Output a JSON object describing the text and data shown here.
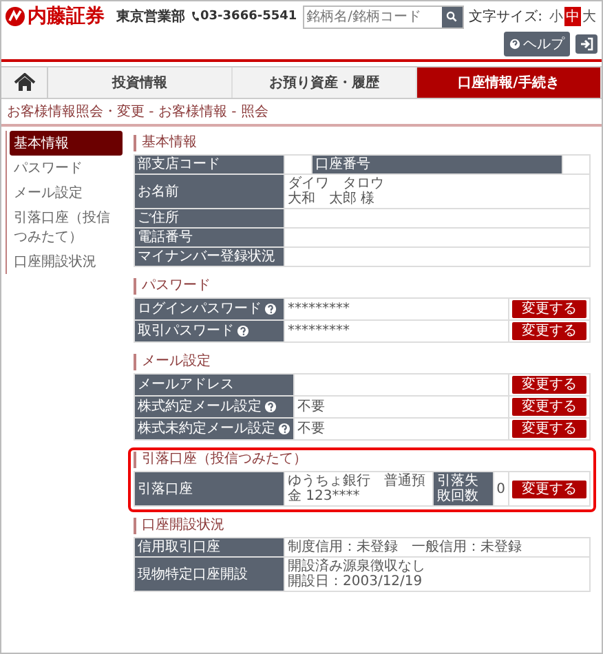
{
  "header": {
    "logo": "内藤証券",
    "branch": "東京営業部",
    "phone": "03-3666-5541",
    "search": {
      "placeholder": "銘柄名/銘柄コード"
    },
    "font_size": {
      "label": "文字サイズ:",
      "options": [
        {
          "label": "小",
          "selected": false
        },
        {
          "label": "中",
          "selected": true
        },
        {
          "label": "大",
          "selected": false
        }
      ]
    },
    "help": "ヘルプ"
  },
  "nav": {
    "tabs": [
      {
        "label": "投資情報",
        "selected": false
      },
      {
        "label": "お預り資産・履歴",
        "selected": false
      },
      {
        "label": "口座情報/手続き",
        "selected": true
      }
    ]
  },
  "breadcrumb": "お客様情報照会・変更 - お客様情報 - 照会",
  "sidebar": {
    "items": [
      {
        "label": "基本情報",
        "selected": true
      },
      {
        "label": "パスワード",
        "selected": false
      },
      {
        "label": "メール設定",
        "selected": false
      },
      {
        "label": "引落口座（投信つみたて）",
        "selected": false
      },
      {
        "label": "口座開設状況",
        "selected": false
      }
    ]
  },
  "sections": [
    {
      "title": "基本情報",
      "highlighted": false,
      "rows": [
        {
          "cells": [
            {
              "kind": "label",
              "text": "部支店コード",
              "help": false
            },
            {
              "kind": "value"
            },
            {
              "kind": "label",
              "text": "口座番号",
              "help": false
            },
            {
              "kind": "value"
            }
          ]
        },
        {
          "cells": [
            {
              "kind": "label",
              "text": "お名前",
              "help": false
            },
            {
              "kind": "value",
              "colspan": 3,
              "lines": [
                "ダイワ　タロウ",
                "大和　太郎 様"
              ]
            }
          ]
        },
        {
          "cells": [
            {
              "kind": "label",
              "text": "ご住所",
              "help": false
            },
            {
              "kind": "value",
              "colspan": 3
            }
          ]
        },
        {
          "cells": [
            {
              "kind": "label",
              "text": "電話番号",
              "help": false
            },
            {
              "kind": "value",
              "colspan": 3
            }
          ]
        },
        {
          "cells": [
            {
              "kind": "label",
              "text": "マイナンバー登録状況",
              "help": false
            },
            {
              "kind": "value",
              "colspan": 3
            }
          ]
        }
      ]
    },
    {
      "title": "パスワード",
      "highlighted": false,
      "rows": [
        {
          "cells": [
            {
              "kind": "label",
              "text": "ログインパスワード",
              "help": true
            },
            {
              "kind": "value",
              "lines": [
                "*********"
              ]
            },
            {
              "kind": "button",
              "text": "変更する"
            }
          ]
        },
        {
          "cells": [
            {
              "kind": "label",
              "text": "取引パスワード",
              "help": true
            },
            {
              "kind": "value",
              "lines": [
                "*********"
              ]
            },
            {
              "kind": "button",
              "text": "変更する"
            }
          ]
        }
      ]
    },
    {
      "title": "メール設定",
      "highlighted": false,
      "rows": [
        {
          "cells": [
            {
              "kind": "label",
              "text": "メールアドレス",
              "help": false
            },
            {
              "kind": "value"
            },
            {
              "kind": "button",
              "text": "変更する"
            }
          ]
        },
        {
          "cells": [
            {
              "kind": "label",
              "text": "株式約定メール設定",
              "help": true
            },
            {
              "kind": "value",
              "lines": [
                "不要"
              ]
            },
            {
              "kind": "button",
              "text": "変更する"
            }
          ]
        },
        {
          "cells": [
            {
              "kind": "label",
              "text": "株式未約定メール設定",
              "help": true
            },
            {
              "kind": "value",
              "lines": [
                "不要"
              ]
            },
            {
              "kind": "button",
              "text": "変更する"
            }
          ]
        }
      ]
    },
    {
      "title": "引落口座（投信つみたて）",
      "highlighted": true,
      "rows": [
        {
          "cells": [
            {
              "kind": "label",
              "text": "引落口座",
              "help": false
            },
            {
              "kind": "value",
              "lines": [
                "ゆうちょ銀行　普通預金 123****"
              ]
            },
            {
              "kind": "label",
              "text": "引落失敗回数",
              "help": false
            },
            {
              "kind": "value",
              "lines": [
                "0"
              ]
            },
            {
              "kind": "button",
              "text": "変更する"
            }
          ]
        }
      ]
    },
    {
      "title": "口座開設状況",
      "highlighted": false,
      "rows": [
        {
          "cells": [
            {
              "kind": "label",
              "text": "信用取引口座",
              "help": false
            },
            {
              "kind": "value",
              "lines": [
                "制度信用：未登録　一般信用：未登録"
              ]
            }
          ]
        },
        {
          "cells": [
            {
              "kind": "label",
              "text": "現物特定口座開設",
              "help": false
            },
            {
              "kind": "value",
              "lines": [
                "開設済み源泉徴収なし",
                "開設日：2003/12/19"
              ]
            }
          ]
        }
      ]
    }
  ]
}
